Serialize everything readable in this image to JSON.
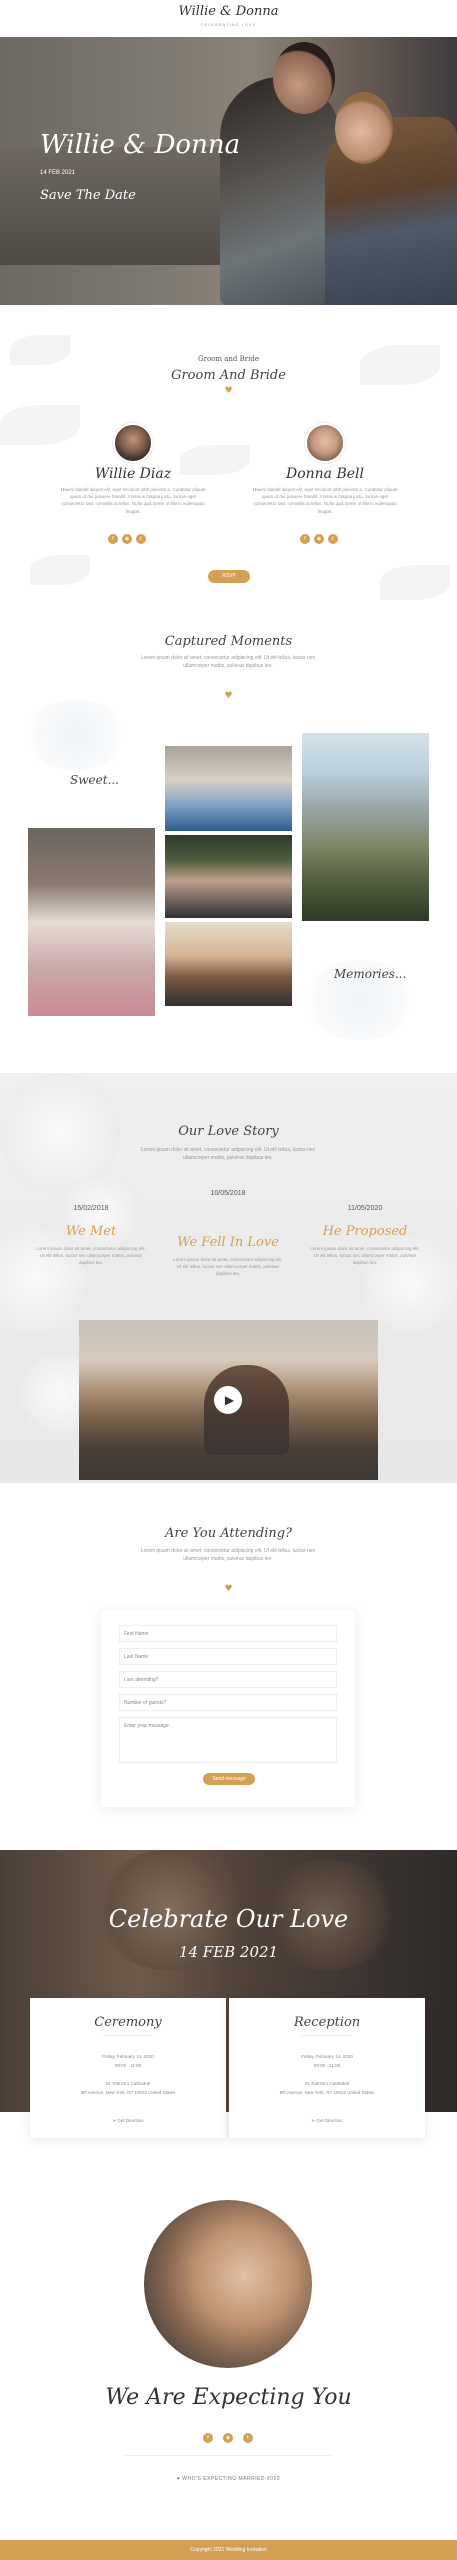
{
  "header": {
    "logo": "Willie & Donna",
    "logo_sub": "CELEBRATING LOVE"
  },
  "hero": {
    "names": "Willie & Donna",
    "date": "14 FEB 2021",
    "tagline": "Save The Date"
  },
  "couple": {
    "subtitle": "Groom and Bride",
    "title": "Groom And Bride",
    "groom": {
      "name": "Willie Diaz",
      "bio": "Mauris blandit aliquet elit, eget tincidunt nibh pulvinar a. Curabitur aliquet quam id dui posuere blandit. Vivamus magna justo, lacinia eget consectetur sed, convallis at tellus. Nulla quis lorem ut libero malesuada feugiat."
    },
    "bride": {
      "name": "Donna Bell",
      "bio": "Mauris blandit aliquet elit, eget tincidunt nibh pulvinar a. Curabitur aliquet quam id dui posuere blandit. Vivamus magna justo, lacinia eget consectetur sed, convallis at tellus. Nulla quis lorem ut libero malesuada feugiat."
    },
    "social_icons": [
      "facebook-icon",
      "instagram-icon",
      "twitter-icon"
    ],
    "button": "RSVP"
  },
  "moments": {
    "title": "Captured Moments",
    "text": "Lorem ipsum dolor sit amet, consectetur adipiscing elit. Ut elit tellus, luctus nec ullamcorper mattis, pulvinar dapibus leo.",
    "label_left": "Sweet...",
    "label_right": "Memories..."
  },
  "story": {
    "title": "Our Love Story",
    "text": "Lorem ipsum dolor sit amet, consectetur adipiscing elit. Ut elit tellus, luctus nec ullamcorper mattis, pulvinar dapibus leo.",
    "events": [
      {
        "date": "15/02/2018",
        "title": "We Met",
        "text": "Lorem ipsum dolor sit amet, consectetur adipiscing elit. Ut elit tellus, luctus nec ullamcorper mattis, pulvinar dapibus leo."
      },
      {
        "date": "10/05/2018",
        "title": "We Fell In Love",
        "text": "Lorem ipsum dolor sit amet, consectetur adipiscing elit. Ut elit tellus, luctus nec ullamcorper mattis, pulvinar dapibus leo."
      },
      {
        "date": "11/05/2020",
        "title": "He Proposed",
        "text": "Lorem ipsum dolor sit amet, consectetur adipiscing elit. Ut elit tellus, luctus nec ullamcorper mattis, pulvinar dapibus leo."
      }
    ],
    "play_icon": "play-icon"
  },
  "attending": {
    "title": "Are You Attending?",
    "text": "Lorem ipsum dolor sit amet, consectetur adipiscing elit. Ut elit tellus, luctus nec ullamcorper mattis, pulvinar dapibus leo.",
    "fields": {
      "first_name": "First Name",
      "last_name": "Last Name",
      "attending": "I am attending?",
      "guests": "Number of guests?",
      "message": "Enter your message"
    },
    "button": "Send message"
  },
  "celebrate": {
    "title": "Celebrate Our Love",
    "date": "14 FEB 2021",
    "ceremony": {
      "title": "Ceremony",
      "line1": "Friday, February 14, 2020",
      "line2": "09:00 - 11:00",
      "place": "St. Patrick's Cathedral",
      "address": "5th Avenue, New York, NY 10022 United States",
      "link": "Get Direction"
    },
    "reception": {
      "title": "Reception",
      "line1": "Friday, February 14, 2020",
      "line2": "09:00 - 11:00",
      "place": "St. Patrick's Cathedral",
      "address": "5th Avenue, New York, NY 10022 United States",
      "link": "Get Direction"
    }
  },
  "expecting": {
    "title": "We Are Expecting You",
    "footer_text": "♥ WHO'S EXPECTING MARRIED 2020"
  },
  "footer": {
    "text": "Copyright 2021 Wedding Invitation"
  },
  "colors": {
    "accent": "#d4a056",
    "text": "#555555",
    "story_bg": "#efefef"
  }
}
